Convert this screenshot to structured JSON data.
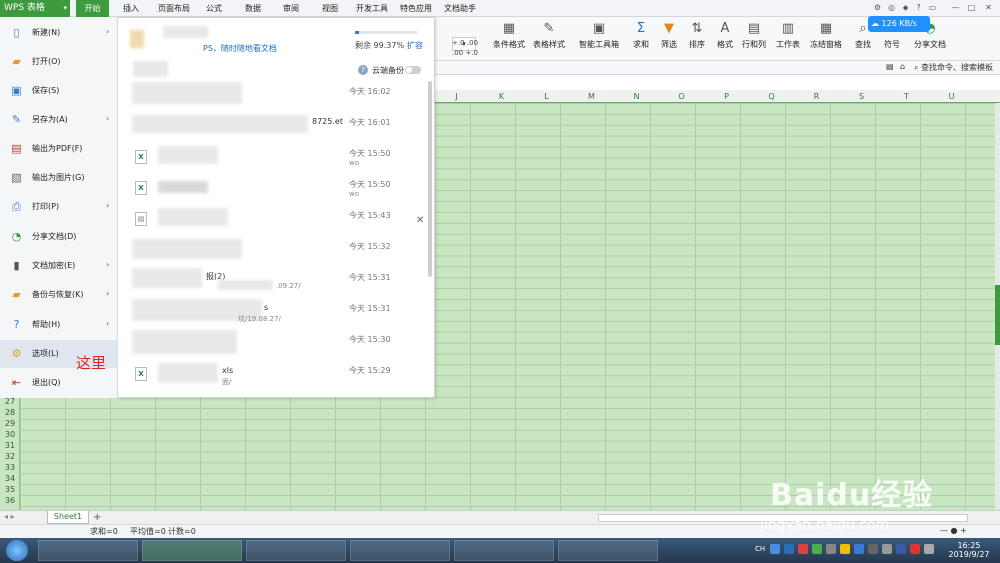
{
  "app": {
    "wps_label": "WPS 表格",
    "menu_tabs": [
      "开始",
      "插入",
      "页面布局",
      "公式",
      "数据",
      "审阅",
      "视图",
      "开发工具",
      "特色应用",
      "文档助手"
    ],
    "active_tab": "开始",
    "cloud_speed": "126 KB/s"
  },
  "ribbon": {
    "buttons": [
      {
        "label": "条件格式",
        "icon": "conditional-format-icon"
      },
      {
        "label": "表格样式",
        "icon": "table-style-icon"
      },
      {
        "label": "智能工具箱",
        "icon": "toolbox-icon"
      },
      {
        "label": "求和",
        "icon": "sum-icon"
      },
      {
        "label": "筛选",
        "icon": "filter-icon"
      },
      {
        "label": "排序",
        "icon": "sort-icon"
      },
      {
        "label": "格式",
        "icon": "format-icon"
      },
      {
        "label": "行和列",
        "icon": "rows-cols-icon"
      },
      {
        "label": "工作表",
        "icon": "worksheet-icon"
      },
      {
        "label": "冻结窗格",
        "icon": "freeze-icon"
      },
      {
        "label": "查找",
        "icon": "find-icon"
      },
      {
        "label": "符号",
        "icon": "symbol-icon"
      },
      {
        "label": "分享文档",
        "icon": "share-icon"
      }
    ],
    "decimal_inc": "+.0 .00",
    "decimal_dec": ".00 +.0",
    "search_placeholder": "查找命令、搜索模板"
  },
  "columns": [
    "J",
    "K",
    "L",
    "M",
    "N",
    "O",
    "P",
    "Q",
    "R",
    "S",
    "T",
    "U"
  ],
  "rows": [
    "27",
    "28",
    "29",
    "30",
    "31",
    "32",
    "33",
    "34",
    "35",
    "36"
  ],
  "file_menu": {
    "items": [
      {
        "label": "新建(N)",
        "icon": "new-file-icon",
        "arrow": true
      },
      {
        "label": "打开(O)",
        "icon": "open-folder-icon",
        "arrow": false
      },
      {
        "label": "保存(S)",
        "icon": "save-icon",
        "arrow": false
      },
      {
        "label": "另存为(A)",
        "icon": "save-as-icon",
        "arrow": true
      },
      {
        "label": "输出为PDF(F)",
        "icon": "pdf-icon",
        "arrow": false
      },
      {
        "label": "输出为图片(G)",
        "icon": "image-export-icon",
        "arrow": false
      },
      {
        "label": "打印(P)",
        "icon": "print-icon",
        "arrow": true
      },
      {
        "label": "分享文档(D)",
        "icon": "share-doc-icon",
        "arrow": false
      },
      {
        "label": "文档加密(E)",
        "icon": "encrypt-icon",
        "arrow": true
      },
      {
        "label": "备份与恢复(K)",
        "icon": "backup-icon",
        "arrow": true
      },
      {
        "label": "帮助(H)",
        "icon": "help-icon",
        "arrow": true
      },
      {
        "label": "选项(L)",
        "icon": "options-gear-icon",
        "arrow": false
      },
      {
        "label": "退出(Q)",
        "icon": "exit-icon",
        "arrow": false
      }
    ],
    "annotation": "这里"
  },
  "recent": {
    "promo_text": "PS，随时随地看文档",
    "storage_text": "剩余 99.37%",
    "storage_fraction": 0.06,
    "expand_label": "扩容",
    "cloud_sync_label": "云端备份",
    "files": [
      {
        "name": "",
        "time": "今天 16:02",
        "sub": ""
      },
      {
        "name": "8725.et",
        "time": "今天 16:01",
        "sub": ""
      },
      {
        "name": "",
        "time": "今天 15:50",
        "sub": "wo"
      },
      {
        "name": "",
        "time": "今天 15:50",
        "sub": "wo"
      },
      {
        "name": "",
        "time": "今天 15:43",
        "sub": ""
      },
      {
        "name": "",
        "time": "今天 15:32",
        "sub": ""
      },
      {
        "name": "报(2)",
        "time": "今天 15:31",
        "sub": ".09.27/"
      },
      {
        "name": "s",
        "time": "今天 15:31",
        "sub": "坟/19.08.27/"
      },
      {
        "name": "",
        "time": "今天 15:30",
        "sub": ""
      },
      {
        "name": "xls",
        "time": "今天 15:29",
        "sub": "面/"
      }
    ]
  },
  "sheets": {
    "tabs": [
      "Sheet1"
    ],
    "add_label": "+"
  },
  "status": {
    "sum": "求和=0",
    "avg": "平均值=0",
    "count": "计数=0"
  },
  "taskbar": {
    "ime": "CH",
    "time": "16:25",
    "date": "2019/9/27"
  },
  "watermark": {
    "main": "Baidu经验",
    "sub": "jingyan.baidu.com"
  }
}
